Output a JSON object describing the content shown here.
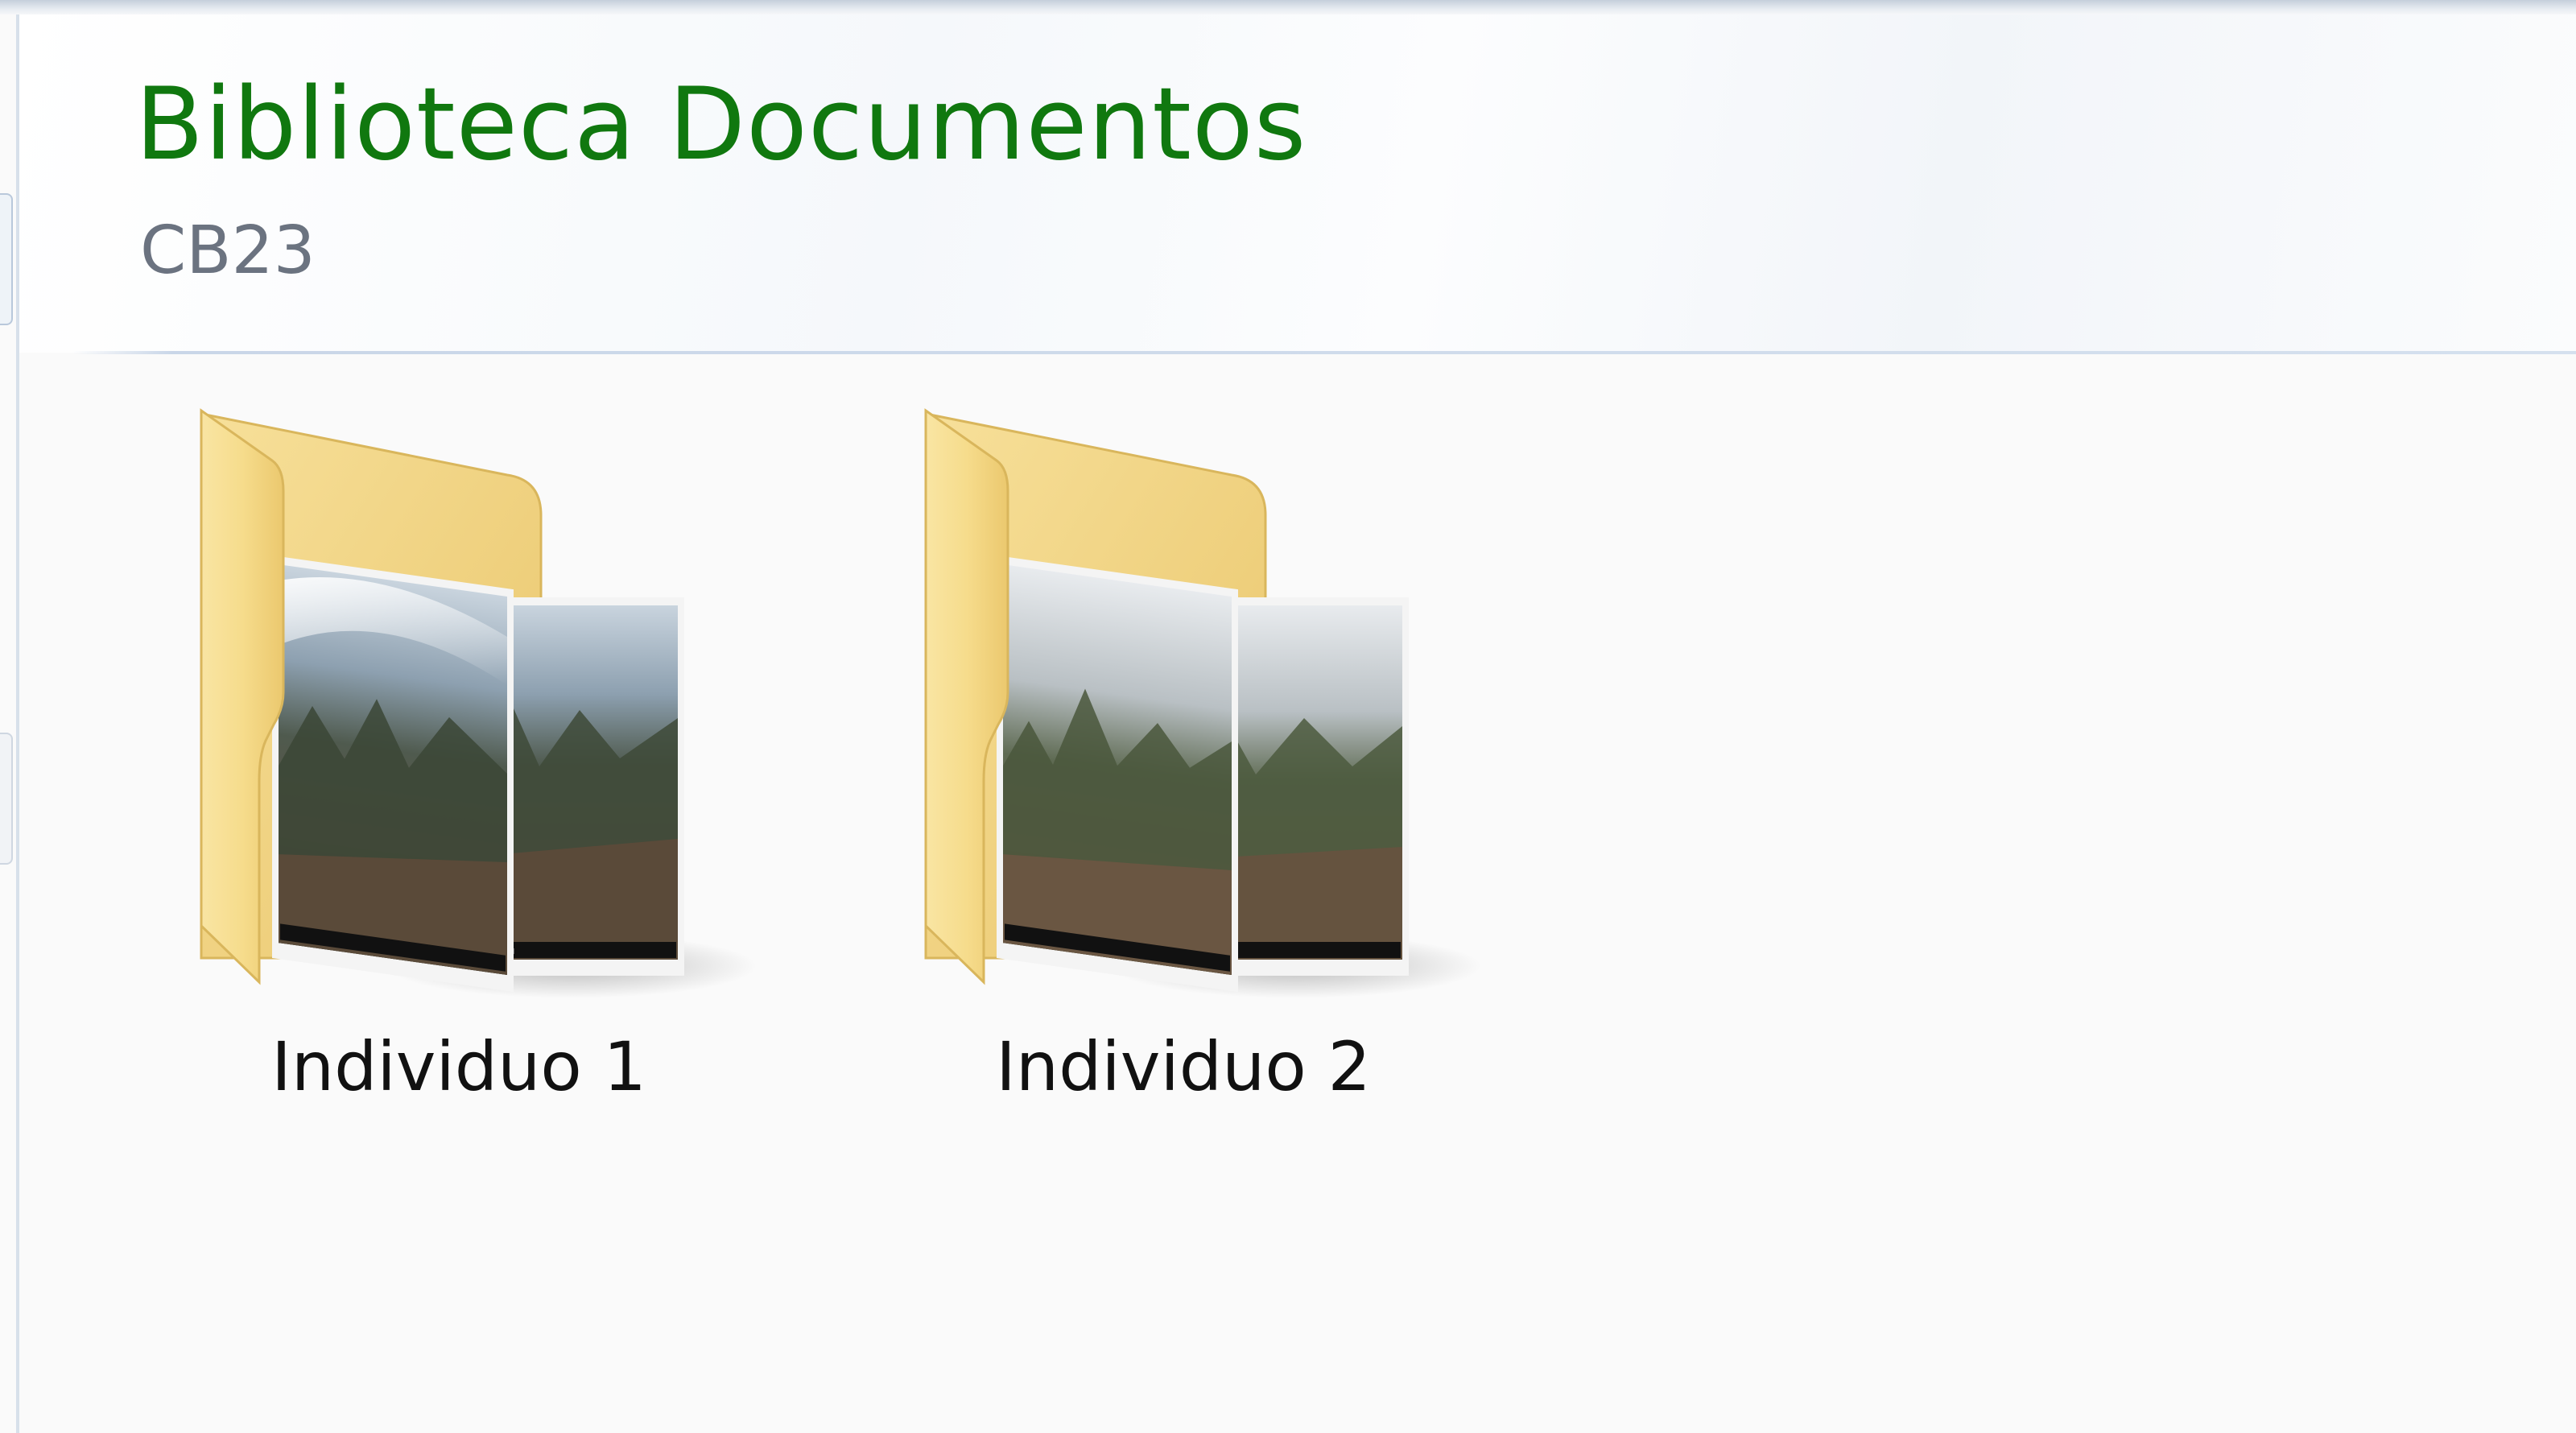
{
  "library": {
    "title": "Biblioteca Documentos",
    "subtitle": "CB23"
  },
  "items": [
    {
      "label": "Individuo 1",
      "icon": "folder-with-photos-icon"
    },
    {
      "label": "Individuo 2",
      "icon": "folder-with-photos-icon"
    }
  ],
  "colors": {
    "title": "#10780f",
    "subtitle": "#6b7380",
    "folder": "#f1d27e",
    "background": "#fafafa"
  }
}
